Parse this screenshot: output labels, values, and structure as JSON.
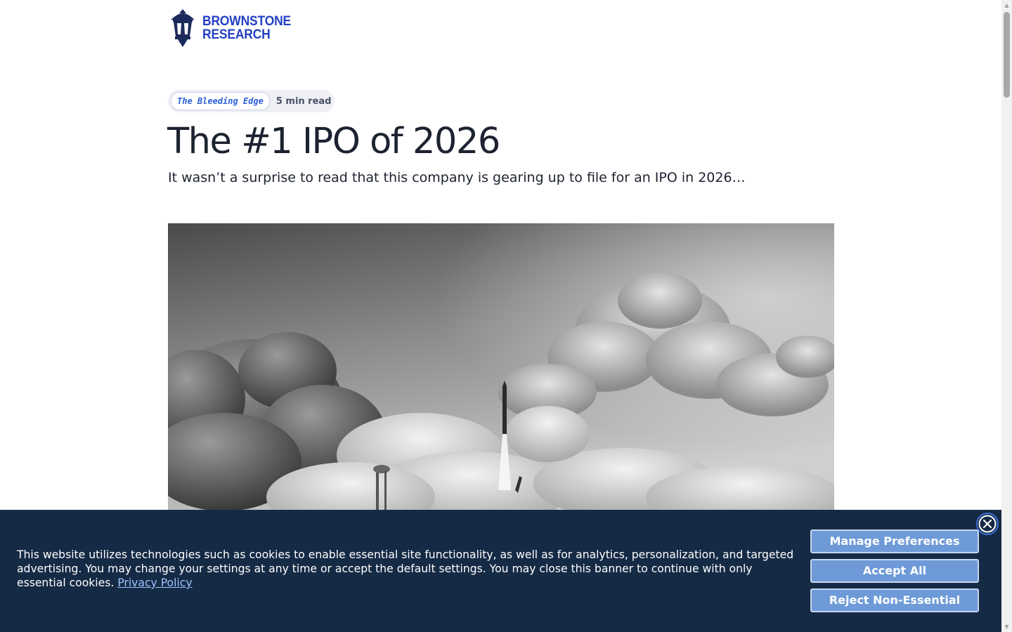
{
  "brand": {
    "name_line1": "BROWNSTONE",
    "name_line2": "RESEARCH",
    "accent_color": "#2440c4",
    "logo_icon": "lantern-icon"
  },
  "article": {
    "category": "The Bleeding Edge",
    "read_time": "5 min read",
    "title": "The #1 IPO of 2026",
    "subtitle": "It wasn’t a surprise to read that this company is gearing up to file for an IPO in 2026…",
    "hero_image": "rocket-launch-photo"
  },
  "cookie_banner": {
    "text": "This website utilizes technologies such as cookies to enable essential site functionality, as well as for analytics, personalization, and targeted advertising. You may change your settings at any time or accept the default settings. You may close this banner to continue with only essential cookies.",
    "privacy_link": "Privacy Policy",
    "buttons": {
      "manage": "Manage Preferences",
      "accept": "Accept All",
      "reject": "Reject Non-Essential"
    },
    "close_icon": "close-icon",
    "background_color": "#152a45",
    "button_color": "#6e9bd8"
  }
}
